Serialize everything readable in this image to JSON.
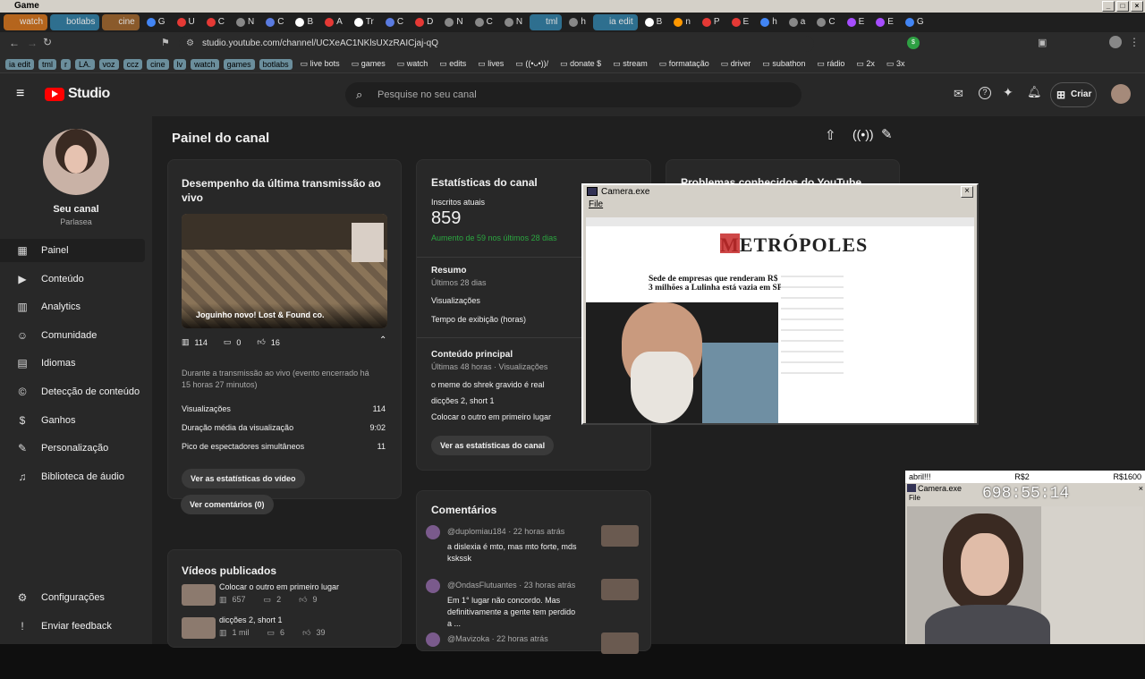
{
  "os": {
    "title": "Game"
  },
  "tabs": [
    {
      "label": "watch",
      "color": "#b5651d"
    },
    {
      "label": "botlabs",
      "color": "#2e6f8f"
    },
    {
      "label": "cine",
      "color": "#8a5a2b"
    },
    {
      "label": "G",
      "color": "#4285f4"
    },
    {
      "label": "U",
      "color": "#e53935"
    },
    {
      "label": "C",
      "color": "#e53935"
    },
    {
      "label": "N",
      "color": "#888888"
    },
    {
      "label": "C",
      "color": "#5a7be0"
    },
    {
      "label": "B",
      "color": "#ffffff"
    },
    {
      "label": "A",
      "color": "#e53935"
    },
    {
      "label": "Tr",
      "color": "#ffffff"
    },
    {
      "label": "C",
      "color": "#5a7be0"
    },
    {
      "label": "D",
      "color": "#e53935"
    },
    {
      "label": "N",
      "color": "#888888"
    },
    {
      "label": "C",
      "color": "#888888"
    },
    {
      "label": "N",
      "color": "#888888"
    },
    {
      "label": "tml",
      "color": "#2e6f8f"
    },
    {
      "label": "h",
      "color": "#888888"
    },
    {
      "label": "ia edit",
      "color": "#2e6f8f"
    },
    {
      "label": "B",
      "color": "#ffffff"
    },
    {
      "label": "n",
      "color": "#ff9800"
    },
    {
      "label": "P",
      "color": "#e53935"
    },
    {
      "label": "E",
      "color": "#e53935"
    },
    {
      "label": "h",
      "color": "#4285f4"
    },
    {
      "label": "a",
      "color": "#888888"
    },
    {
      "label": "C",
      "color": "#888888"
    },
    {
      "label": "E",
      "color": "#a64dff"
    },
    {
      "label": "E",
      "color": "#a64dff"
    },
    {
      "label": "G",
      "color": "#4285f4"
    }
  ],
  "address": {
    "url": "studio.youtube.com/channel/UCXeAC1NKlsUXzRAICjaj-qQ"
  },
  "bookmarks": {
    "pills": [
      "ia edit",
      "tml",
      "r",
      "LA.",
      "voz",
      "ccz",
      "cine",
      "lv",
      "watch",
      "games",
      "botlabs"
    ],
    "folders": [
      "live bots",
      "games",
      "watch",
      "edits",
      "lives",
      "((•ᴗ•))/",
      "donate $",
      "stream",
      "formatação",
      "driver",
      "subathon",
      "rádio",
      "2x",
      "3x"
    ]
  },
  "studio": {
    "logo": "Studio",
    "search_placeholder": "Pesquise no seu canal",
    "create_label": "Criar"
  },
  "sidebar": {
    "channel_name": "Seu canal",
    "channel_handle": "Parlasea",
    "items": [
      {
        "label": "Painel",
        "icon": "dashboard-icon"
      },
      {
        "label": "Conteúdo",
        "icon": "content-icon"
      },
      {
        "label": "Analytics",
        "icon": "analytics-icon"
      },
      {
        "label": "Comunidade",
        "icon": "community-icon"
      },
      {
        "label": "Idiomas",
        "icon": "languages-icon"
      },
      {
        "label": "Detecção de conteúdo",
        "icon": "copyright-icon"
      },
      {
        "label": "Ganhos",
        "icon": "earn-icon"
      },
      {
        "label": "Personalização",
        "icon": "customization-icon"
      },
      {
        "label": "Biblioteca de áudio",
        "icon": "audio-library-icon"
      }
    ],
    "footer": [
      {
        "label": "Configurações",
        "icon": "gear-icon"
      },
      {
        "label": "Enviar feedback",
        "icon": "feedback-icon"
      }
    ]
  },
  "dashboard": {
    "title": "Painel do canal",
    "live": {
      "title": "Desempenho da última transmissão ao vivo",
      "thumb_caption": "Joguinho novo! Lost & Found co.",
      "views": "114",
      "comments": "0",
      "likes": "16",
      "note": "Durante a transmissão ao vivo (evento encerrado há 15 horas 27 minutos)",
      "metrics": [
        {
          "label": "Visualizações",
          "value": "114"
        },
        {
          "label": "Duração média da visualização",
          "value": "9:02"
        },
        {
          "label": "Pico de espectadores simultâneos",
          "value": "11"
        }
      ],
      "btn_stats": "Ver as estatísticas do vídeo",
      "btn_comments": "Ver comentários (0)"
    },
    "published": {
      "title": "Vídeos publicados",
      "items": [
        {
          "title": "Colocar o outro em primeiro lugar",
          "views": "657",
          "comments": "2",
          "likes": "9"
        },
        {
          "title": "dicções 2, short 1",
          "views": "1 mil",
          "comments": "6",
          "likes": "39"
        }
      ]
    },
    "stats": {
      "title": "Estatísticas do canal",
      "subs_label": "Inscritos atuais",
      "subs_value": "859",
      "subs_change": "Aumento de 59 nos últimos 28 dias",
      "summary_title": "Resumo",
      "summary_period": "Últimos 28 dias",
      "summary_rows": [
        "Visualizações",
        "Tempo de exibição (horas)"
      ],
      "top_title": "Conteúdo principal",
      "top_period": "Últimas 48 horas · Visualizações",
      "top_items": [
        "o meme do shrek gravido é real",
        "dicções 2, short 1",
        "Colocar o outro em primeiro lugar"
      ],
      "btn": "Ver as estatísticas do canal"
    },
    "problems_title": "Problemas conhecidos do YouTube",
    "comments": {
      "title": "Comentários",
      "items": [
        {
          "user": "@duplomiau184",
          "time": "22 horas atrás",
          "text": "a dislexia é mto, mas mto forte, mds kskssk"
        },
        {
          "user": "@OndasFlutuantes",
          "time": "23 horas atrás",
          "text": "Em 1° lugar não concordo. Mas definitivamente a gente tem perdido a ..."
        },
        {
          "user": "@Mavizoka",
          "time": "22 horas atrás",
          "text": ""
        }
      ]
    }
  },
  "camera1": {
    "title": "Camera.exe",
    "menu": "File",
    "site_logo": "METRÓPOLES",
    "headline": "Sede de empresas que renderam R$ 3 milhões a Lulinha está vazia em SP"
  },
  "camera2": {
    "goal_label": "abril!!!",
    "goal_mid": "R$2",
    "goal_right": "R$1600",
    "title": "Camera.exe",
    "menu": "File",
    "timer": "698:55:14"
  }
}
